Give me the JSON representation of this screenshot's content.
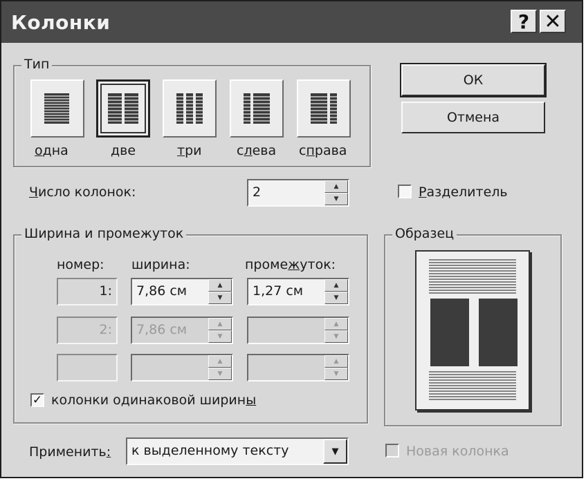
{
  "window": {
    "title": "Колонки",
    "help_glyph": "?",
    "close_glyph": "✕"
  },
  "type_group": {
    "legend": "Тип",
    "presets": [
      {
        "label": "одна",
        "accesskey": "о",
        "rest": "дна",
        "columns": 1,
        "selected": false
      },
      {
        "label": "две",
        "accesskey": "д",
        "rest": "ве",
        "columns": 2,
        "selected": true
      },
      {
        "label": "три",
        "accesskey": "т",
        "rest": "ри",
        "columns": 3,
        "selected": false
      },
      {
        "label": "слева",
        "accesskey": "л",
        "rest_before": "с",
        "rest_after": "ева",
        "selected": false
      },
      {
        "label": "справа",
        "accesskey": "п",
        "rest_before": "с",
        "rest_after": "рава",
        "selected": false
      }
    ]
  },
  "buttons": {
    "ok": "ОК",
    "cancel": "Отмена"
  },
  "num_columns": {
    "label_key": "Ч",
    "label_rest": "исло колонок:",
    "value": "2"
  },
  "separator": {
    "label_key": "Р",
    "label_rest": "азделитель",
    "checked": false
  },
  "width_group": {
    "legend": "Ширина и промежуток",
    "headers": {
      "number": "номер:",
      "width": "ширина:",
      "spacing_before": "проме",
      "spacing_key": "ж",
      "spacing_after": "уток:"
    },
    "rows": [
      {
        "number": "1:",
        "width": "7,86 см",
        "spacing": "1,27 см",
        "enabled": true
      },
      {
        "number": "2:",
        "width": "7,86 см",
        "spacing": "",
        "enabled": false
      },
      {
        "number": "",
        "width": "",
        "spacing": "",
        "enabled": false
      }
    ],
    "equal_width": {
      "label_before": "колонки одинаковой ширин",
      "label_key": "ы",
      "checked": true,
      "check_glyph": "✓"
    }
  },
  "sample": {
    "legend": "Образец",
    "columns": 2
  },
  "apply": {
    "label_before": "Применить",
    "label_key": ":",
    "value": "к выделенному тексту",
    "dropdown_glyph": "▼"
  },
  "new_column": {
    "label": "Новая колонка",
    "checked": false,
    "enabled": false
  },
  "spin_glyphs": {
    "up": "▲",
    "down": "▼"
  }
}
